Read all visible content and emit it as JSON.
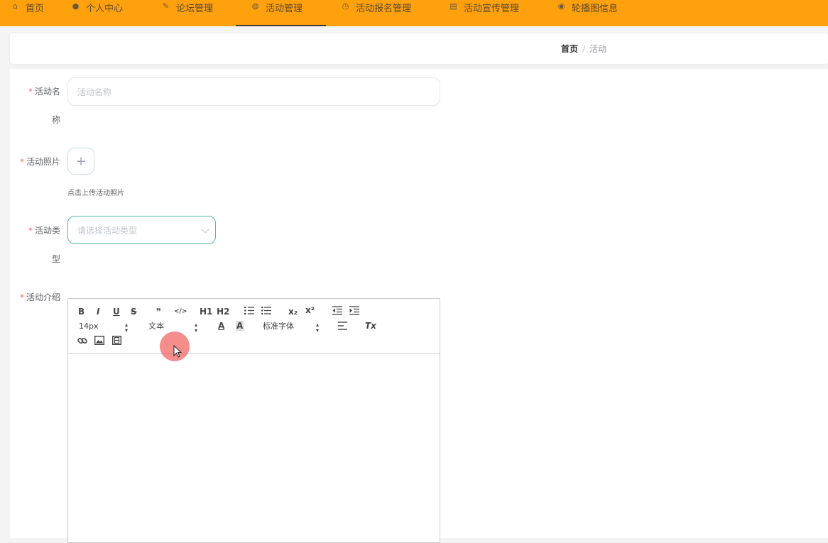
{
  "nav": {
    "items": [
      {
        "label": "首页",
        "icon": "home-icon"
      },
      {
        "label": "个人中心",
        "icon": "user-icon"
      },
      {
        "label": "论坛管理",
        "icon": "edit-icon"
      },
      {
        "label": "活动管理",
        "icon": "globe-icon",
        "active": true
      },
      {
        "label": "活动报名管理",
        "icon": "clock-icon"
      },
      {
        "label": "活动宣传管理",
        "icon": "doc-icon"
      },
      {
        "label": "轮播图信息",
        "icon": "pin-icon"
      }
    ],
    "bg_color": "#ffa00d"
  },
  "breadcrumb": {
    "home": "首页",
    "separator": "/",
    "current": "活动"
  },
  "form": {
    "name": {
      "label_line1": "活动名",
      "label_line2": "称",
      "placeholder": "活动名称"
    },
    "photo": {
      "label": "活动照片",
      "upload_symbol": "+",
      "tip": "点击上传活动照片"
    },
    "type": {
      "label_line1": "活动类",
      "label_line2": "型",
      "placeholder": "请选择活动类型"
    },
    "intro": {
      "label": "活动介绍"
    },
    "required_mark": "*"
  },
  "editor": {
    "row1": [
      "B",
      "I",
      "U",
      "S",
      "❞",
      "</>",
      "H1",
      "H2",
      "ol",
      "ul",
      "x₂",
      "x²",
      "outdent",
      "indent"
    ],
    "font_size": "14px",
    "header_select": "文本",
    "font_family": "标准字体",
    "clean": "Tx"
  }
}
